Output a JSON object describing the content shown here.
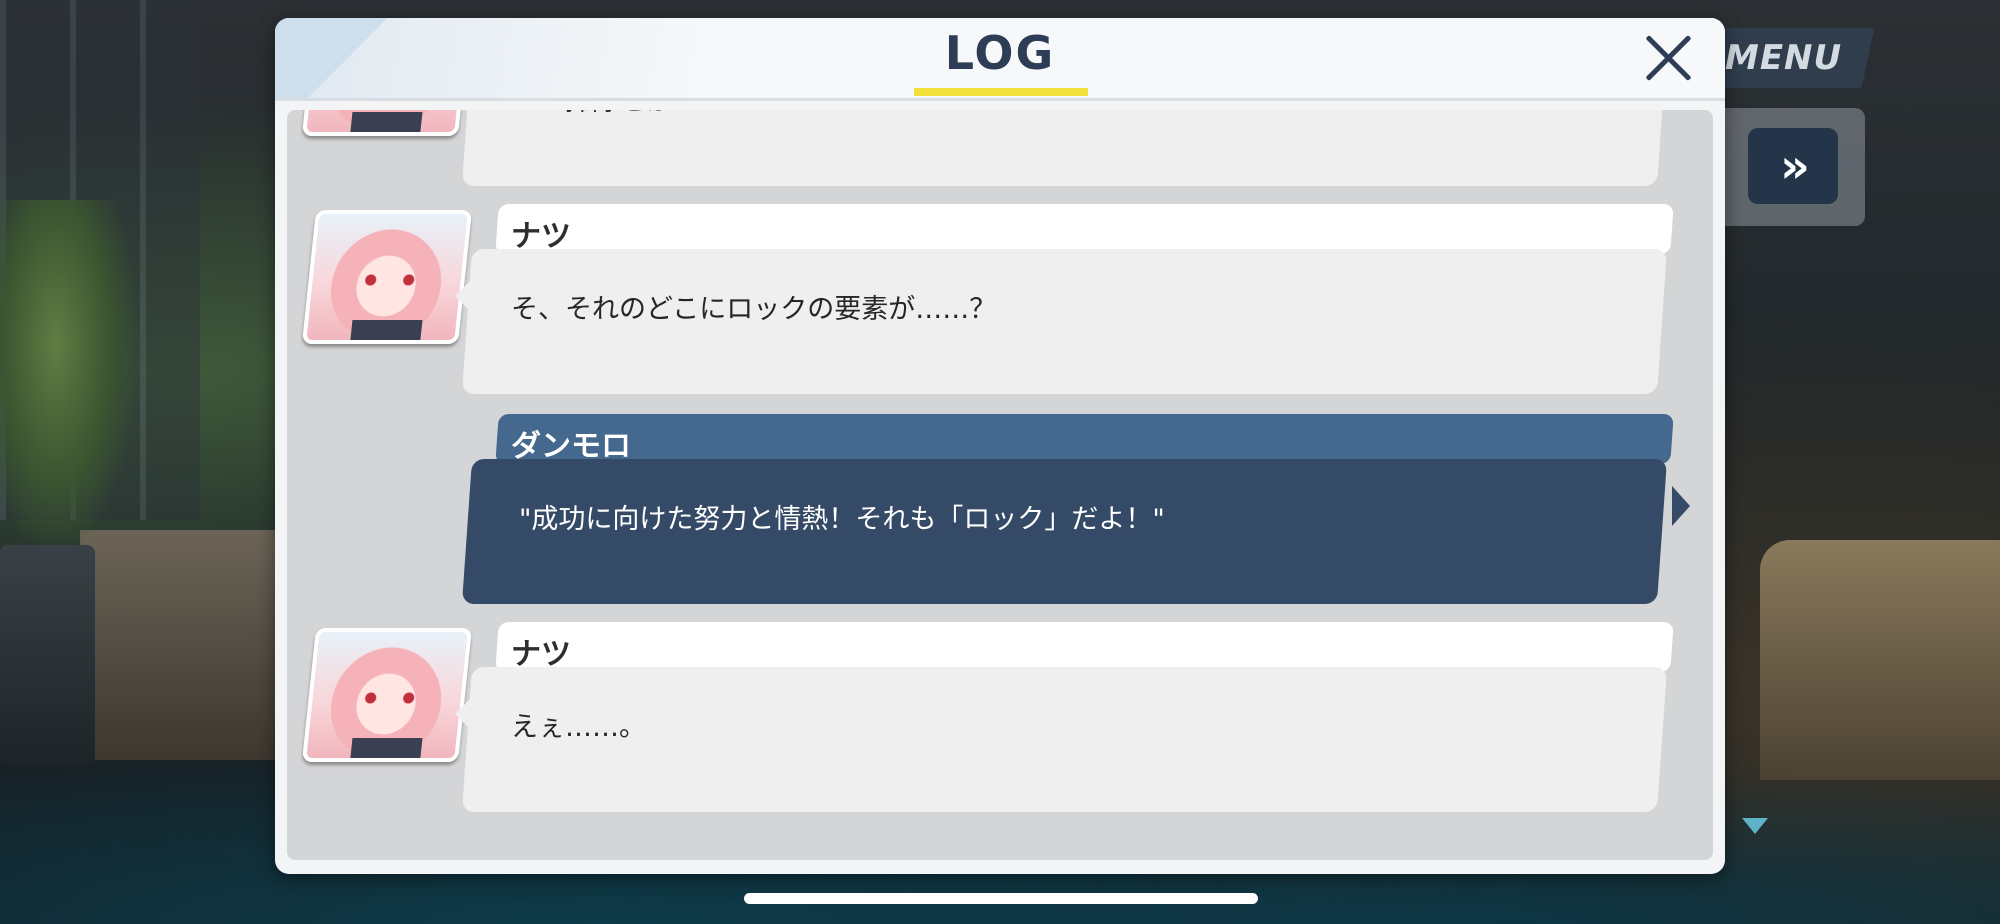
{
  "overlay": {
    "menu_label": "MENU",
    "fast_forward_icon": "fast-forward-icon",
    "next_icon": "down-triangle-icon"
  },
  "modal": {
    "title": "LOG",
    "close_icon": "close-icon",
    "colors": {
      "title": "#2c3d55",
      "underline": "#f1e03a",
      "player_name_bar": "#44688e",
      "player_bubble": "#354a66",
      "npc_bubble": "#efefef"
    }
  },
  "log": {
    "entries": [
      {
        "speaker": "ナツ",
        "text": "……掃除とか？",
        "is_player": false
      },
      {
        "speaker": "ナツ",
        "text": "そ、それのどこにロックの要素が……？",
        "is_player": false
      },
      {
        "speaker": "ダンモロ",
        "text": "\"成功に向けた努力と情熱！それも「ロック」だよ！\"",
        "is_player": true
      },
      {
        "speaker": "ナツ",
        "text": "えぇ……。",
        "is_player": false
      }
    ]
  }
}
